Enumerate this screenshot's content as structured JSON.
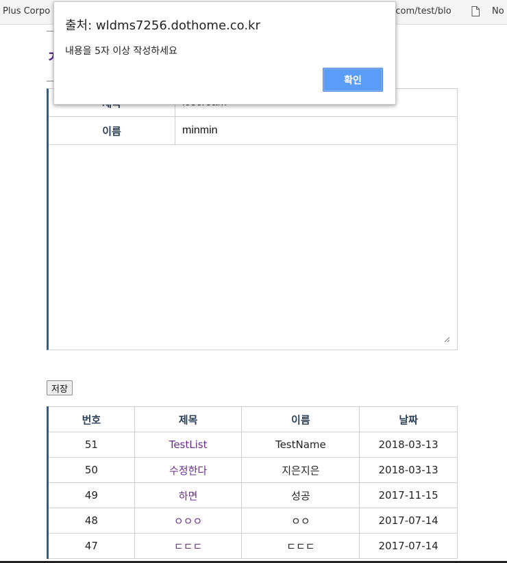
{
  "bookmarks": {
    "left_text": "Plus Corpo",
    "mid_text": "g.com/test/blo",
    "right_text": "No",
    "doc_icon": "document-icon"
  },
  "page": {
    "heading_visible": "ㅈ"
  },
  "form": {
    "title_label": "제목",
    "title_value": "icecream",
    "name_label": "이름",
    "name_value": "minmin",
    "content_value": ""
  },
  "save_label": "저장",
  "list": {
    "headers": [
      "번호",
      "제목",
      "이름",
      "날짜"
    ],
    "rows": [
      [
        "51",
        "TestList",
        "TestName",
        "2018-03-13"
      ],
      [
        "50",
        "수정한다",
        "지은지은",
        "2018-03-13"
      ],
      [
        "49",
        "하면",
        "성공",
        "2017-11-15"
      ],
      [
        "48",
        "ㅇㅇㅇ",
        "ㅇㅇ",
        "2017-07-14"
      ],
      [
        "47",
        "ㄷㄷㄷ",
        "ㄷㄷㄷ",
        "2017-07-14"
      ]
    ]
  },
  "alert": {
    "title": "출처: wldms7256.dothome.co.kr",
    "message": "내용을 5자 이상 작성하세요",
    "ok_label": "확인"
  },
  "colors": {
    "accent_button": "#5b9cf8",
    "heading": "#5b2a86",
    "table_border_left": "#3c5a78",
    "link_title": "#6a2e8a"
  }
}
